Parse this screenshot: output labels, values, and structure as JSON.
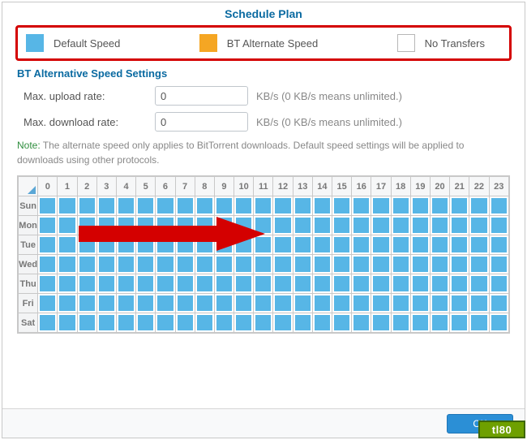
{
  "title": "Schedule Plan",
  "legend": {
    "default": "Default Speed",
    "alternate": "BT Alternate Speed",
    "none": "No Transfers"
  },
  "settings": {
    "title": "BT Alternative Speed Settings",
    "upload_label": "Max. upload rate:",
    "download_label": "Max. download rate:",
    "upload_value": "0",
    "download_value": "0",
    "suffix": "KB/s (0 KB/s means unlimited.)"
  },
  "note": {
    "label": "Note:",
    "text": " The alternate speed only applies to BitTorrent downloads. Default speed settings will be applied to downloads using other protocols."
  },
  "schedule": {
    "hours": [
      "0",
      "1",
      "2",
      "3",
      "4",
      "5",
      "6",
      "7",
      "8",
      "9",
      "10",
      "11",
      "12",
      "13",
      "14",
      "15",
      "16",
      "17",
      "18",
      "19",
      "20",
      "21",
      "22",
      "23"
    ],
    "days": [
      "Sun",
      "Mon",
      "Tue",
      "Wed",
      "Thu",
      "Fri",
      "Sat"
    ]
  },
  "buttons": {
    "ok": "OK"
  },
  "watermark": "tl80"
}
